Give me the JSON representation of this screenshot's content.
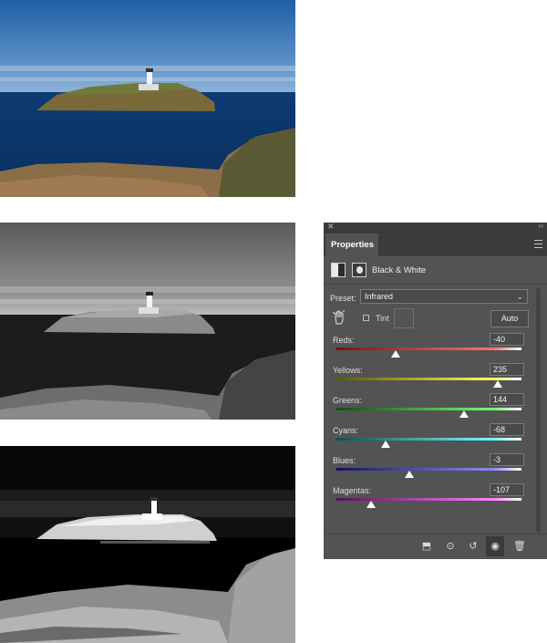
{
  "panel": {
    "tab_label": "Properties",
    "adjustment_title": "Black & White",
    "preset_label": "Preset:",
    "preset_value": "Infrared",
    "tint_label": "Tint",
    "tint_checked": false,
    "auto_label": "Auto",
    "sliders": [
      {
        "label": "Reds:",
        "value": "-40",
        "num": -40,
        "colors": [
          "#7a1010",
          "#ff7070"
        ]
      },
      {
        "label": "Yellows:",
        "value": "235",
        "num": 235,
        "colors": [
          "#585800",
          "#ffff60"
        ]
      },
      {
        "label": "Greens:",
        "value": "144",
        "num": 144,
        "colors": [
          "#0f4d0f",
          "#70ff70"
        ]
      },
      {
        "label": "Cyans:",
        "value": "-68",
        "num": -68,
        "colors": [
          "#0d4f56",
          "#70ffff"
        ]
      },
      {
        "label": "Blues:",
        "value": "-3",
        "num": -3,
        "colors": [
          "#12125a",
          "#8a8aff"
        ]
      },
      {
        "label": "Magentas:",
        "value": "-107",
        "num": -107,
        "colors": [
          "#551055",
          "#ff80ff"
        ]
      }
    ],
    "slider_range": [
      -200,
      300
    ],
    "footer_icons": [
      "clip-to-layer-icon",
      "view-previous-state-icon",
      "reset-icon",
      "visibility-eye-icon",
      "trash-icon"
    ]
  }
}
